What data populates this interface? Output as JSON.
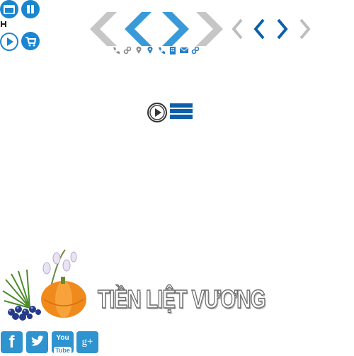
{
  "top_left": {
    "icons": [
      "calendar-icon",
      "pause-icon",
      "film-icon",
      "play-icon",
      "cart-icon"
    ]
  },
  "nav_arrows": {
    "large": [
      "arrow-left-gray",
      "arrow-left-blue",
      "arrow-right-blue",
      "arrow-right-gray"
    ],
    "small": [
      "arrow-left-gray",
      "arrow-left-blue",
      "arrow-right-blue",
      "arrow-right-gray"
    ],
    "colors": {
      "gray": "#c6c6c6",
      "blue": "#3a9ad9",
      "dark_blue": "#0b5fab"
    }
  },
  "contact_icons": [
    "phone-icon",
    "link-icon",
    "location-icon",
    "location-icon",
    "phone-icon",
    "building-icon",
    "mail-icon",
    "link-icon"
  ],
  "controls": {
    "play": "play-icon",
    "menu": "menu-icon"
  },
  "logo": {
    "name": "TIỀN LIỆT VƯƠNG"
  },
  "social": {
    "facebook": "f",
    "twitter": "t",
    "youtube_top": "You",
    "youtube_bottom": "Tube",
    "google": "g+"
  }
}
